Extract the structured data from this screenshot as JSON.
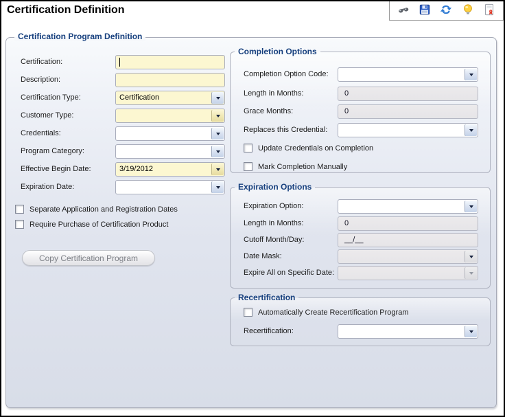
{
  "header": {
    "title": "Certification Definition"
  },
  "panel": {
    "legend": "Certification Program Definition",
    "certification_label": "Certification:",
    "certification_value": "",
    "description_label": "Description:",
    "description_value": "",
    "certification_type_label": "Certification Type:",
    "certification_type_value": "Certification",
    "customer_type_label": "Customer Type:",
    "customer_type_value": "",
    "credentials_label": "Credentials:",
    "credentials_value": "",
    "program_category_label": "Program Category:",
    "program_category_value": "",
    "effective_begin_date_label": "Effective Begin Date:",
    "effective_begin_date_value": "3/19/2012",
    "expiration_date_label": "Expiration Date:",
    "expiration_date_value": "",
    "separate_dates_checkbox": "Separate Application and Registration Dates",
    "require_purchase_checkbox": "Require Purchase of Certification Product",
    "copy_button": "Copy Certification Program"
  },
  "completion": {
    "legend": "Completion Options",
    "option_code_label": "Completion Option Code:",
    "option_code_value": "",
    "length_label": "Length in Months:",
    "length_value": "0",
    "grace_label": "Grace Months:",
    "grace_value": "0",
    "replaces_label": "Replaces this Credential:",
    "replaces_value": "",
    "update_credentials_checkbox": "Update Credentials on Completion",
    "mark_manual_checkbox": "Mark Completion Manually"
  },
  "expiration": {
    "legend": "Expiration Options",
    "option_label": "Expiration Option:",
    "option_value": "",
    "length_label": "Length in Months:",
    "length_value": "0",
    "cutoff_label": "Cutoff Month/Day:",
    "cutoff_value": "__/__",
    "date_mask_label": "Date Mask:",
    "date_mask_value": "",
    "expire_all_label": "Expire All on Specific Date:",
    "expire_all_value": ""
  },
  "recertification": {
    "legend": "Recertification",
    "auto_create_checkbox": "Automatically Create Recertification Program",
    "recert_label": "Recertification:",
    "recert_value": ""
  },
  "colors": {
    "legend_text": "#17407e",
    "required_field_bg": "#fcf7d1",
    "panel_bg": "#dde2ec",
    "disabled_bg": "#e8e8eb"
  }
}
